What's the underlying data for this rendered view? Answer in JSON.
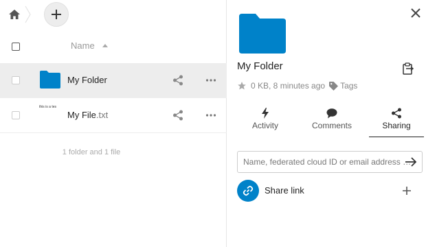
{
  "files": {
    "header": {
      "name_label": "Name"
    },
    "rows": [
      {
        "name": "My Folder",
        "ext": "",
        "type": "folder"
      },
      {
        "name": "My File",
        "ext": ".txt",
        "type": "file",
        "preview": "this is a tes"
      }
    ],
    "summary": "1 folder and 1 file"
  },
  "details": {
    "title": "My Folder",
    "size_time": "0 KB, 8 minutes ago",
    "tags_label": "Tags",
    "tabs": [
      {
        "label": "Activity",
        "icon": "bolt-icon"
      },
      {
        "label": "Comments",
        "icon": "comment-icon"
      },
      {
        "label": "Sharing",
        "icon": "share-icon",
        "active": true
      }
    ],
    "share_placeholder": "Name, federated cloud ID or email address …",
    "share_link_label": "Share link"
  },
  "colors": {
    "accent": "#0082c9",
    "selected_row": "#ededed"
  }
}
